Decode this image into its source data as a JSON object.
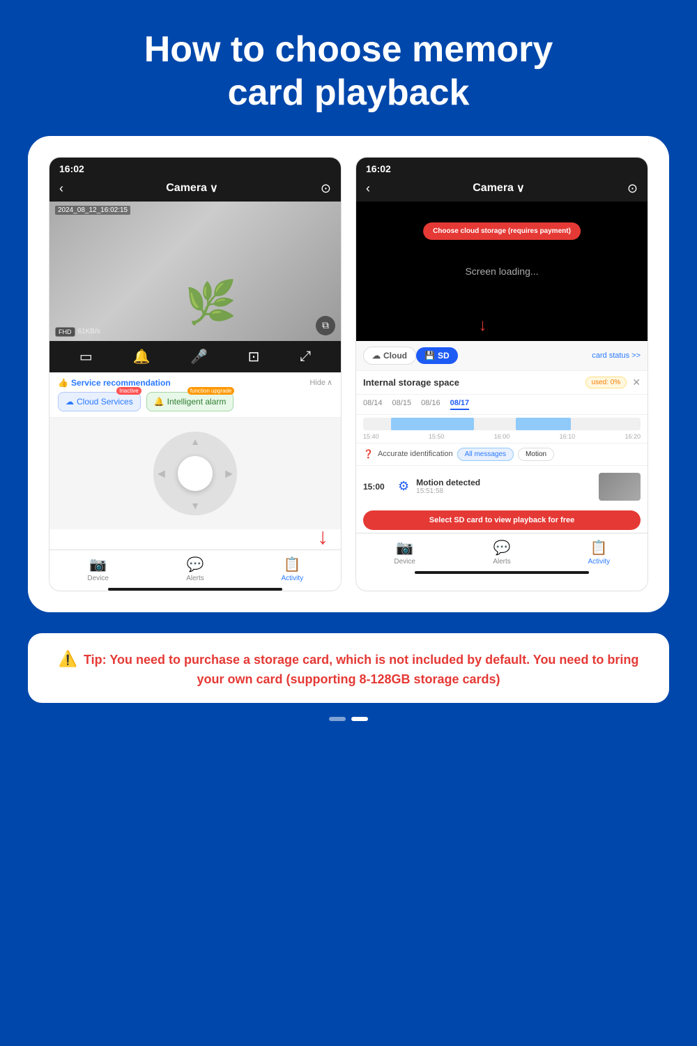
{
  "page": {
    "title_line1": "How to choose memory",
    "title_line2": "card playback",
    "background_color": "#0047ab"
  },
  "left_phone": {
    "status_time": "16:02",
    "nav_title": "Camera",
    "camera_timestamp": "2024_08_12_16:02:15",
    "fhd_label": "FHD",
    "speed_label": "61KB/s",
    "service_rec_title": "Service recommendation",
    "hide_label": "Hide",
    "cloud_btn_label": "Cloud Services",
    "cloud_badge": "Inactive",
    "alarm_btn_label": "Intelligent alarm",
    "alarm_badge": "function upgrade",
    "bottom_nav": [
      {
        "label": "Device",
        "icon": "📷",
        "active": false
      },
      {
        "label": "Alerts",
        "icon": "💬",
        "active": false
      },
      {
        "label": "Activity",
        "icon": "📋",
        "active": true
      }
    ]
  },
  "right_phone": {
    "status_time": "16:02",
    "nav_title": "Camera",
    "loading_text": "Screen loading...",
    "cloud_callout": "Choose cloud storage (requires payment)",
    "tab_cloud": "Cloud",
    "tab_sd": "SD",
    "card_status_label": "card status >>",
    "storage_title": "Internal storage space",
    "storage_used": "used: 0%",
    "dates": [
      "08/14",
      "08/15",
      "08/16",
      "08/17"
    ],
    "active_date": "08/17",
    "timeline_labels": [
      "15:40",
      "15:50",
      "16:00",
      "16:10",
      "16:20"
    ],
    "filter_label": "Accurate identification",
    "filter_btns": [
      "All messages",
      "Motion"
    ],
    "active_filter": "All messages",
    "event_time": "15:00",
    "event_title": "Motion detected",
    "event_sub": "15:51:58",
    "sd_callout": "Select SD card to view playback for free",
    "bottom_nav": [
      {
        "label": "Device",
        "icon": "📷",
        "active": false
      },
      {
        "label": "Alerts",
        "icon": "💬",
        "active": false
      },
      {
        "label": "Activity",
        "icon": "📋",
        "active": true
      }
    ]
  },
  "tip": {
    "icon": "⚠️",
    "text": "Tip: You need to purchase a storage card, which is not included by default. You need to bring your own card (supporting 8-128GB storage cards)"
  },
  "pagination": {
    "dots": [
      false,
      true
    ]
  }
}
